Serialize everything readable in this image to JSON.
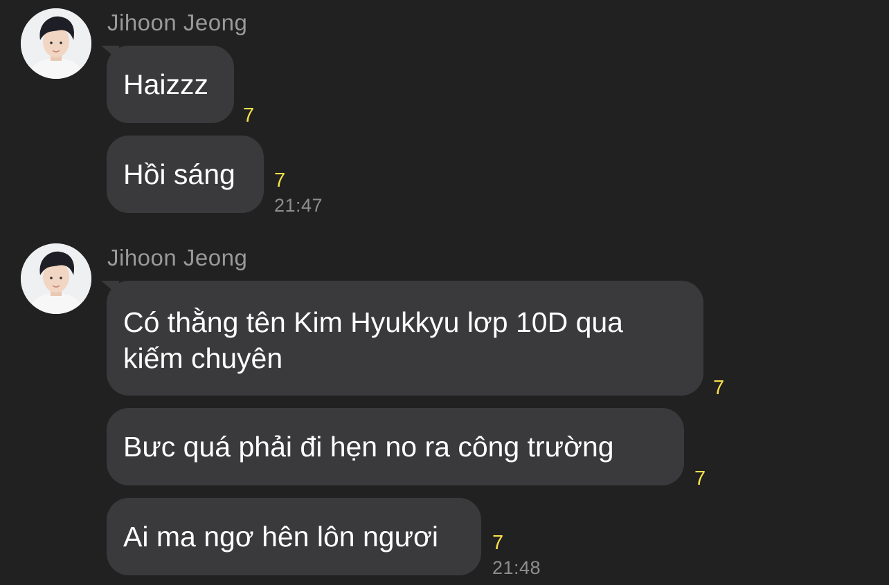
{
  "colors": {
    "background": "#212121",
    "bubble": "#3a3a3c",
    "unread_count": "#f7e04a",
    "sender_name": "#9a9a9a",
    "timestamp": "#8e8e8e"
  },
  "groups": [
    {
      "sender": "Jihoon Jeong",
      "avatar_icon": "profile-photo",
      "messages": [
        {
          "text": "Haizzz",
          "unread": "7",
          "time": ""
        },
        {
          "text": "Hồi sáng",
          "unread": "7",
          "time": "21:47"
        }
      ]
    },
    {
      "sender": "Jihoon Jeong",
      "avatar_icon": "profile-photo",
      "messages": [
        {
          "text": "Có thằng tên Kim Hyukkyu lơp 10D qua\nkiếm chuyên",
          "unread": "7",
          "time": ""
        },
        {
          "text": "Bưc quá phải đi hẹn no ra công trường",
          "unread": "7",
          "time": ""
        },
        {
          "text": "Ai ma ngơ hên lôn ngươi",
          "unread": "7",
          "time": "21:48"
        }
      ]
    }
  ]
}
